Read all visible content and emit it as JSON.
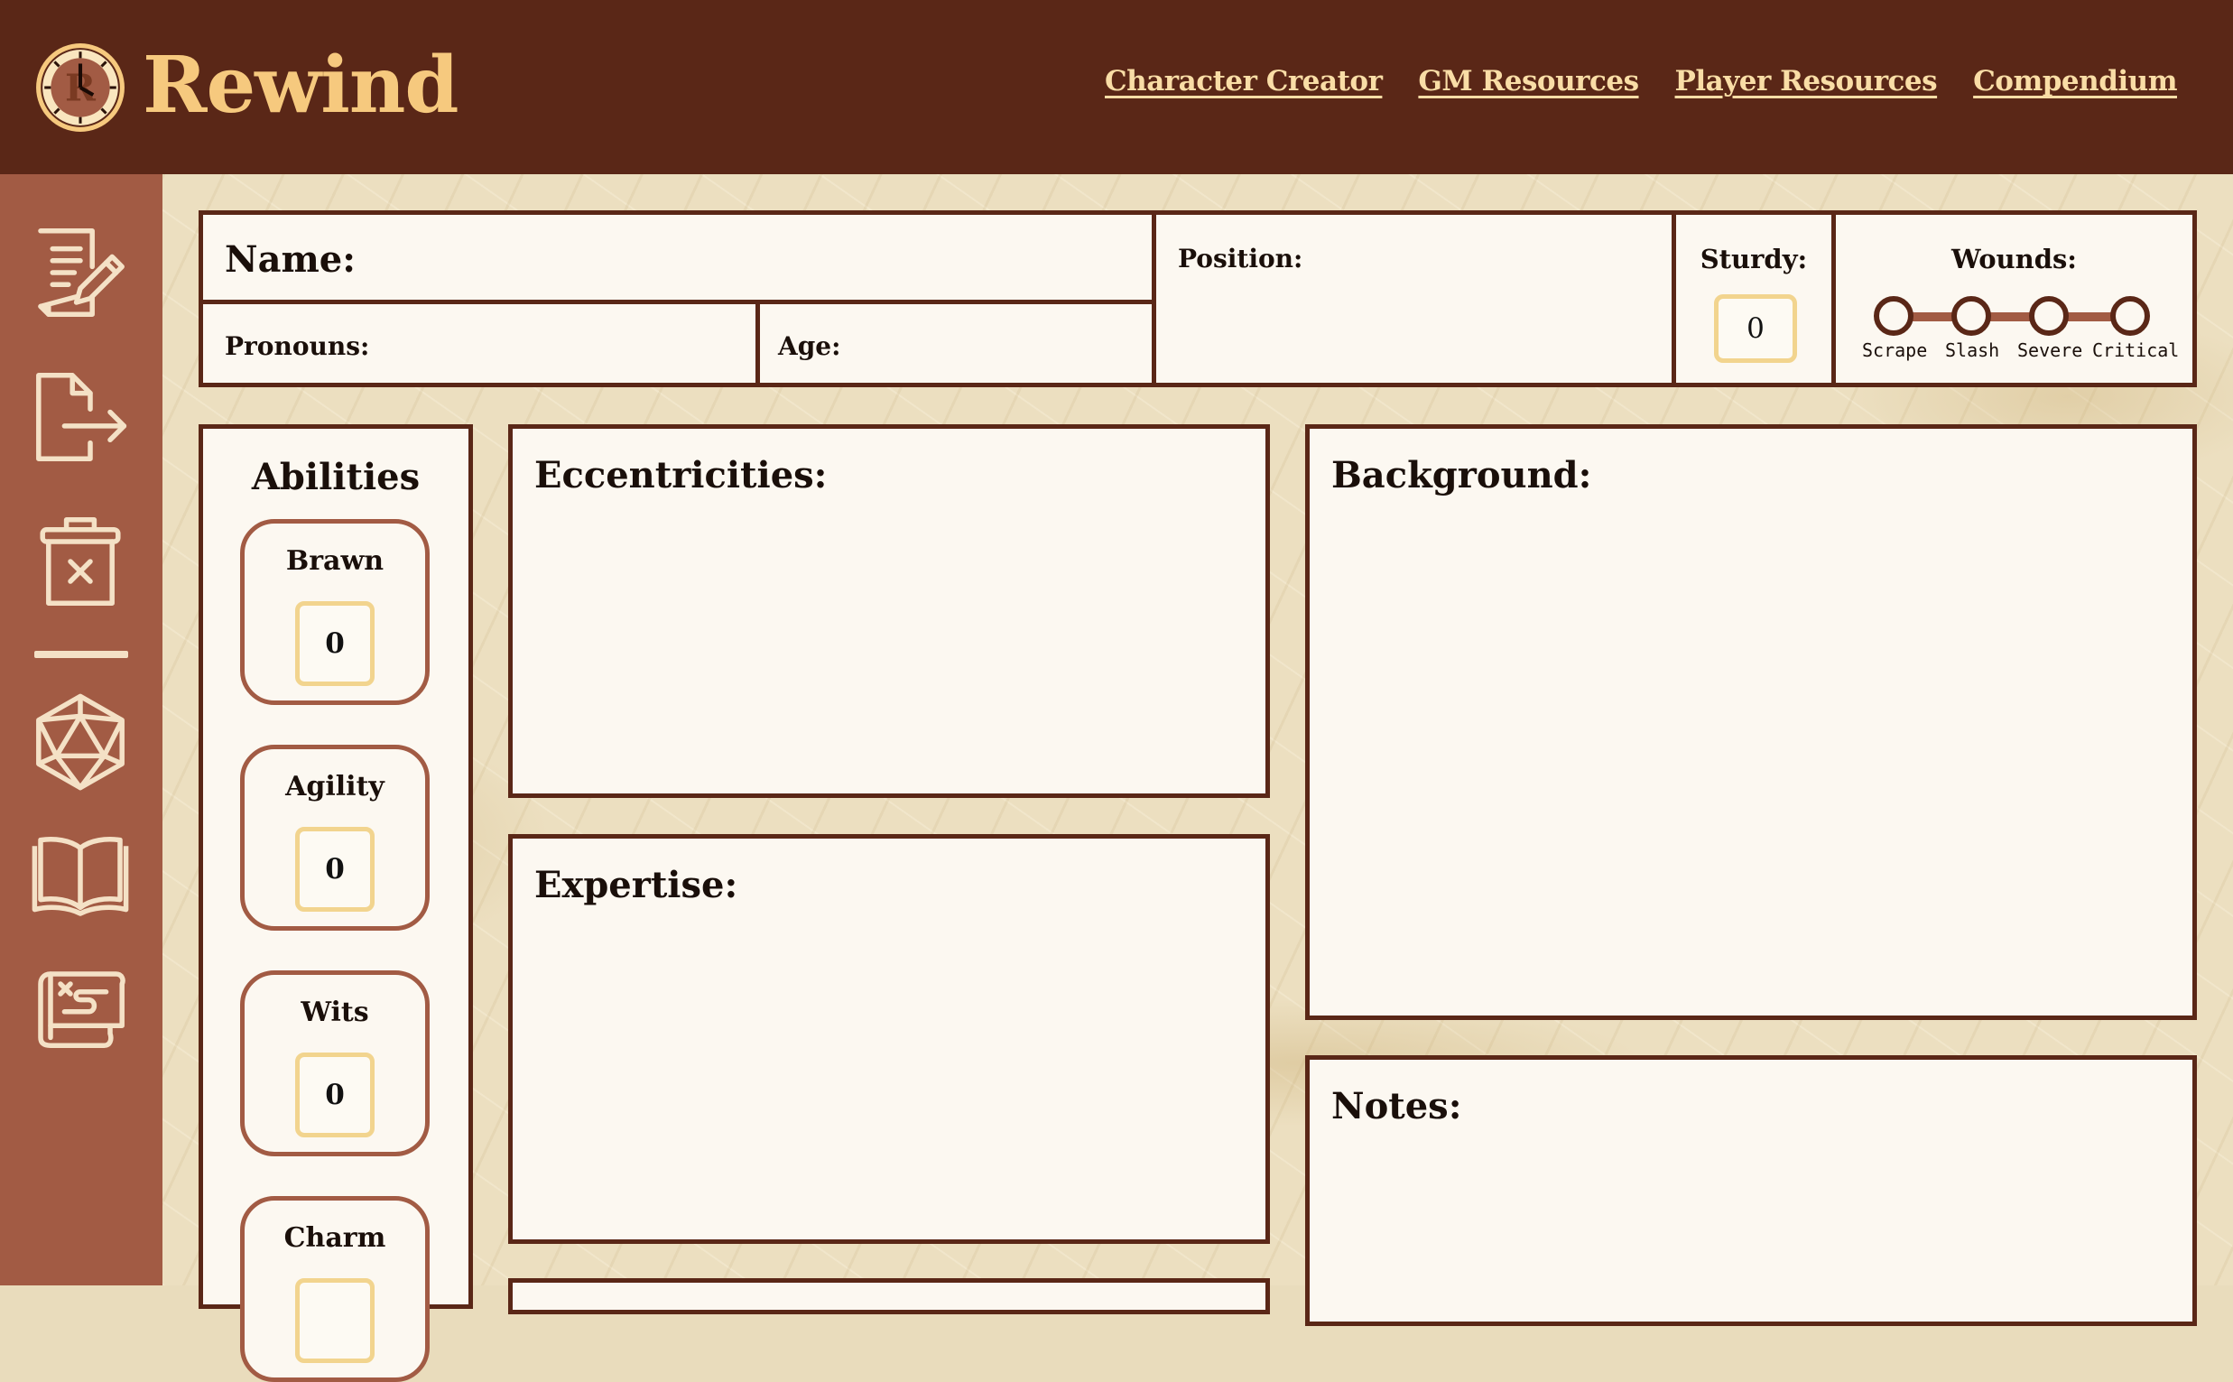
{
  "header": {
    "app_name": "Rewind",
    "nav": [
      "Character Creator",
      "GM Resources",
      "Player Resources",
      "Compendium"
    ]
  },
  "sidebar": {
    "icons": [
      "edit-sheet-icon",
      "export-icon",
      "delete-icon",
      "d20-dice-icon",
      "book-icon",
      "scroll-map-icon"
    ]
  },
  "sheet": {
    "name_label": "Name:",
    "position_label": "Position:",
    "sturdy_label": "Sturdy:",
    "sturdy_value": "0",
    "wounds_label": "Wounds:",
    "wounds": [
      "Scrape",
      "Slash",
      "Severe",
      "Critical"
    ],
    "pronouns_label": "Pronouns:",
    "age_label": "Age:",
    "abilities_title": "Abilities",
    "abilities": [
      {
        "name": "Brawn",
        "value": "0"
      },
      {
        "name": "Agility",
        "value": "0"
      },
      {
        "name": "Wits",
        "value": "0"
      },
      {
        "name": "Charm",
        "value": ""
      }
    ],
    "eccentricities_label": "Eccentricities:",
    "expertise_label": "Expertise:",
    "background_label": "Background:",
    "notes_label": "Notes:"
  },
  "colors": {
    "header_bg": "#5a2717",
    "sidebar_bg": "#a25b44",
    "accent_gold": "#f6c97e",
    "box_border": "#5a2717",
    "value_border": "#f2d48e"
  }
}
